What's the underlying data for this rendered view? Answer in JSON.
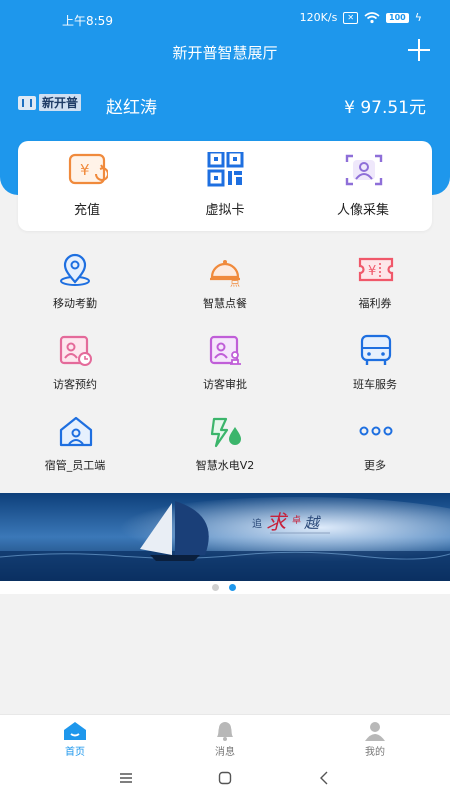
{
  "status": {
    "time": "上午8:59",
    "speed": "120K/s",
    "battery": "100"
  },
  "header": {
    "title": "新开普智慧展厅",
    "logo_text": "新开普",
    "user_name": "赵红涛",
    "balance": "¥  97.51元"
  },
  "quick_actions": [
    {
      "label": "充值",
      "icon": "recharge-icon"
    },
    {
      "label": "虚拟卡",
      "icon": "qr-code-icon"
    },
    {
      "label": "人像采集",
      "icon": "face-capture-icon"
    }
  ],
  "grid": [
    {
      "label": "移动考勤",
      "icon": "location-pin-icon"
    },
    {
      "label": "智慧点餐",
      "icon": "dining-cloche-icon"
    },
    {
      "label": "福利券",
      "icon": "coupon-icon"
    },
    {
      "label": "访客预约",
      "icon": "visitor-booking-icon"
    },
    {
      "label": "访客审批",
      "icon": "visitor-approval-icon"
    },
    {
      "label": "班车服务",
      "icon": "bus-icon"
    },
    {
      "label": "宿管_员工端",
      "icon": "dorm-house-icon"
    },
    {
      "label": "智慧水电V2",
      "icon": "water-electric-icon"
    },
    {
      "label": "更多",
      "icon": "more-dots-icon"
    }
  ],
  "banner": {
    "slogan": "追求卓越",
    "slides": 2,
    "active_slide": 2
  },
  "tabs": [
    {
      "label": "首页",
      "icon": "home-icon",
      "active": true
    },
    {
      "label": "消息",
      "icon": "bell-icon",
      "active": false
    },
    {
      "label": "我的",
      "icon": "person-icon",
      "active": false
    }
  ],
  "colors": {
    "primary": "#1e97ec",
    "orange": "#f08a3c",
    "purple": "#8e6fd8",
    "red": "#f0586a",
    "pink": "#e46a9a",
    "green": "#3bb56b"
  }
}
